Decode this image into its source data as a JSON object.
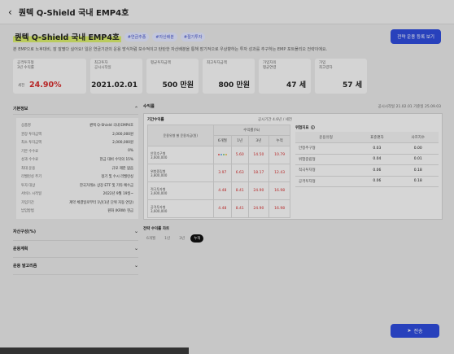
{
  "window": {
    "title": "퀀텍 Q-Shield 국내 EMP4호"
  },
  "fund": {
    "name": "퀀텍 Q-Shield 국내 EMP4호",
    "tags": [
      "#연금추종",
      "#자산배분",
      "#절기투자"
    ],
    "register_button": "전략 운용 등록 보기",
    "description": "본 EMP으로 노후대비, 잠 잘펼다 실어요! 일은 연금기관의 운용 방식처럼 보수적이고 탄탄한 자산배분을 통해 장기적으로 우상향하는 투자 성과를 추구하는 EMP 포트폴리오 전략이에요."
  },
  "stats": [
    {
      "label": "공격투자형\n3년 수익률",
      "prefix": "세전",
      "value": "24.90%",
      "accent": true
    },
    {
      "label": "최고투자\n공시시작일",
      "value": "2021.02.01"
    },
    {
      "label": "평균투자금액",
      "value": "500 만원"
    },
    {
      "label": "최고투자금액",
      "value": "800 만원"
    },
    {
      "label": "가입자의\n평균연령",
      "value": "47 세"
    },
    {
      "label": "가입\n최고령자",
      "value": "57 세"
    }
  ],
  "meta_date": "공시시작일 21.02.01 기준일 25.09.03",
  "basic_info": {
    "header": "기본정보",
    "rows": [
      {
        "k": "상품명",
        "v": "퀀텍 Q-Shield 국내 EMP4호"
      },
      {
        "k": "권장 투자금액",
        "v": "2,000,000원"
      },
      {
        "k": "최소 투자금액",
        "v": "2,000,000원"
      },
      {
        "k": "기본 수수료",
        "v": "0%"
      },
      {
        "k": "성과 수수료",
        "v": "현금 대비 수익의 15%"
      },
      {
        "k": "최대 운용",
        "v": "규모 제한 없음"
      },
      {
        "k": "리밸런싱 주기",
        "v": "정기 및 수시 리밸런싱"
      },
      {
        "k": "투자 대상",
        "v": "한국거래소 상장 ETF 및 기타 예수금"
      },
      {
        "k": "서비스 시작일",
        "v": "2022년 9월 19일~"
      },
      {
        "k": "가입기간",
        "v": "계약 체결일로부터 1년(1년 단위 자동 연장)"
      },
      {
        "k": "납입방법",
        "v": "원화 (KRW) 현금"
      }
    ]
  },
  "accordions": [
    "자산구성(%)",
    "운용계획",
    "운용 발고리즘"
  ],
  "returns": {
    "section": "수익률",
    "sub_title": "기간수익률",
    "sub_note": "공시기간 4.6년 / 세전",
    "headers": [
      "운용유형 별\n운용자금(원)",
      "6개월",
      "1년",
      "3년",
      "누적"
    ],
    "group_header": "수익률(%)",
    "rows": [
      {
        "name": "안정추구형\n3,600,000",
        "vals": [
          "",
          "5.60",
          "14.50",
          "10.79"
        ]
      },
      {
        "name": "위험중립형\n3,800,000",
        "vals": [
          "3.97",
          "6.63",
          "18.17",
          "12.43"
        ]
      },
      {
        "name": "적극투자형\n3,600,000",
        "vals": [
          "4.48",
          "8.41",
          "24.90",
          "16.98"
        ]
      },
      {
        "name": "공격투자형\n3,600,000",
        "vals": [
          "4.48",
          "8.41",
          "24.90",
          "16.98"
        ]
      }
    ],
    "dots": [
      "#e25555",
      "#5aa0e6",
      "#6cc56c",
      "#e6b64a"
    ]
  },
  "risk": {
    "title": "위험지표",
    "info_icon": "i",
    "headers": [
      "운용유형",
      "표준편차",
      "샤프지수"
    ],
    "rows": [
      [
        "안정추구형",
        "0.03",
        "0.00"
      ],
      [
        "위험중립형",
        "0.04",
        "0.01"
      ],
      [
        "적극투자형",
        "0.06",
        "0.18"
      ],
      [
        "공격투자형",
        "0.06",
        "0.18"
      ]
    ]
  },
  "chart": {
    "title": "전략 수익률 차트",
    "periods": [
      "6개월",
      "1년",
      "3년",
      "누적"
    ],
    "active": "누적"
  },
  "send_button": "전송"
}
